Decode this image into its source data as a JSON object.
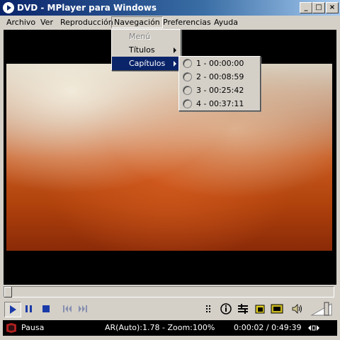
{
  "window": {
    "title": "DVD - MPlayer para Windows",
    "minimize_label": "_",
    "maximize_label": "□",
    "close_label": "×"
  },
  "menubar": {
    "items": [
      "Archivo",
      "Ver",
      "Reproducción",
      "Navegación",
      "Preferencias",
      "Ayuda"
    ],
    "active": "Navegación"
  },
  "navigation_menu": {
    "items": [
      {
        "label": "Menú",
        "disabled": true
      },
      {
        "label": "Títulos",
        "submenu": true
      },
      {
        "label": "Capítulos",
        "submenu": true,
        "selected": true
      }
    ]
  },
  "chapters_menu": {
    "items": [
      "1 - 00:00:00",
      "2 - 00:08:59",
      "3 - 00:25:42",
      "4 - 00:37:11"
    ]
  },
  "controls": {
    "buttons": [
      "play-icon",
      "pause-icon",
      "stop-icon",
      "skip-back-icon",
      "skip-forward-icon",
      "playlist-icon",
      "info-icon",
      "equalizer-icon",
      "screenshot-icon",
      "fullscreen-icon",
      "mute-icon"
    ],
    "volume_percent": 80,
    "seek_position_fraction": 0.0007
  },
  "status": {
    "state": "Pausa",
    "info": "AR(Auto):1.78 - Zoom:100%",
    "time": "0:00:02 / 0:49:39"
  },
  "colors": {
    "titlebar_start": "#0a246a",
    "titlebar_end": "#a6caf0",
    "menu_selected": "#0a246a",
    "status_bg": "#000000"
  }
}
